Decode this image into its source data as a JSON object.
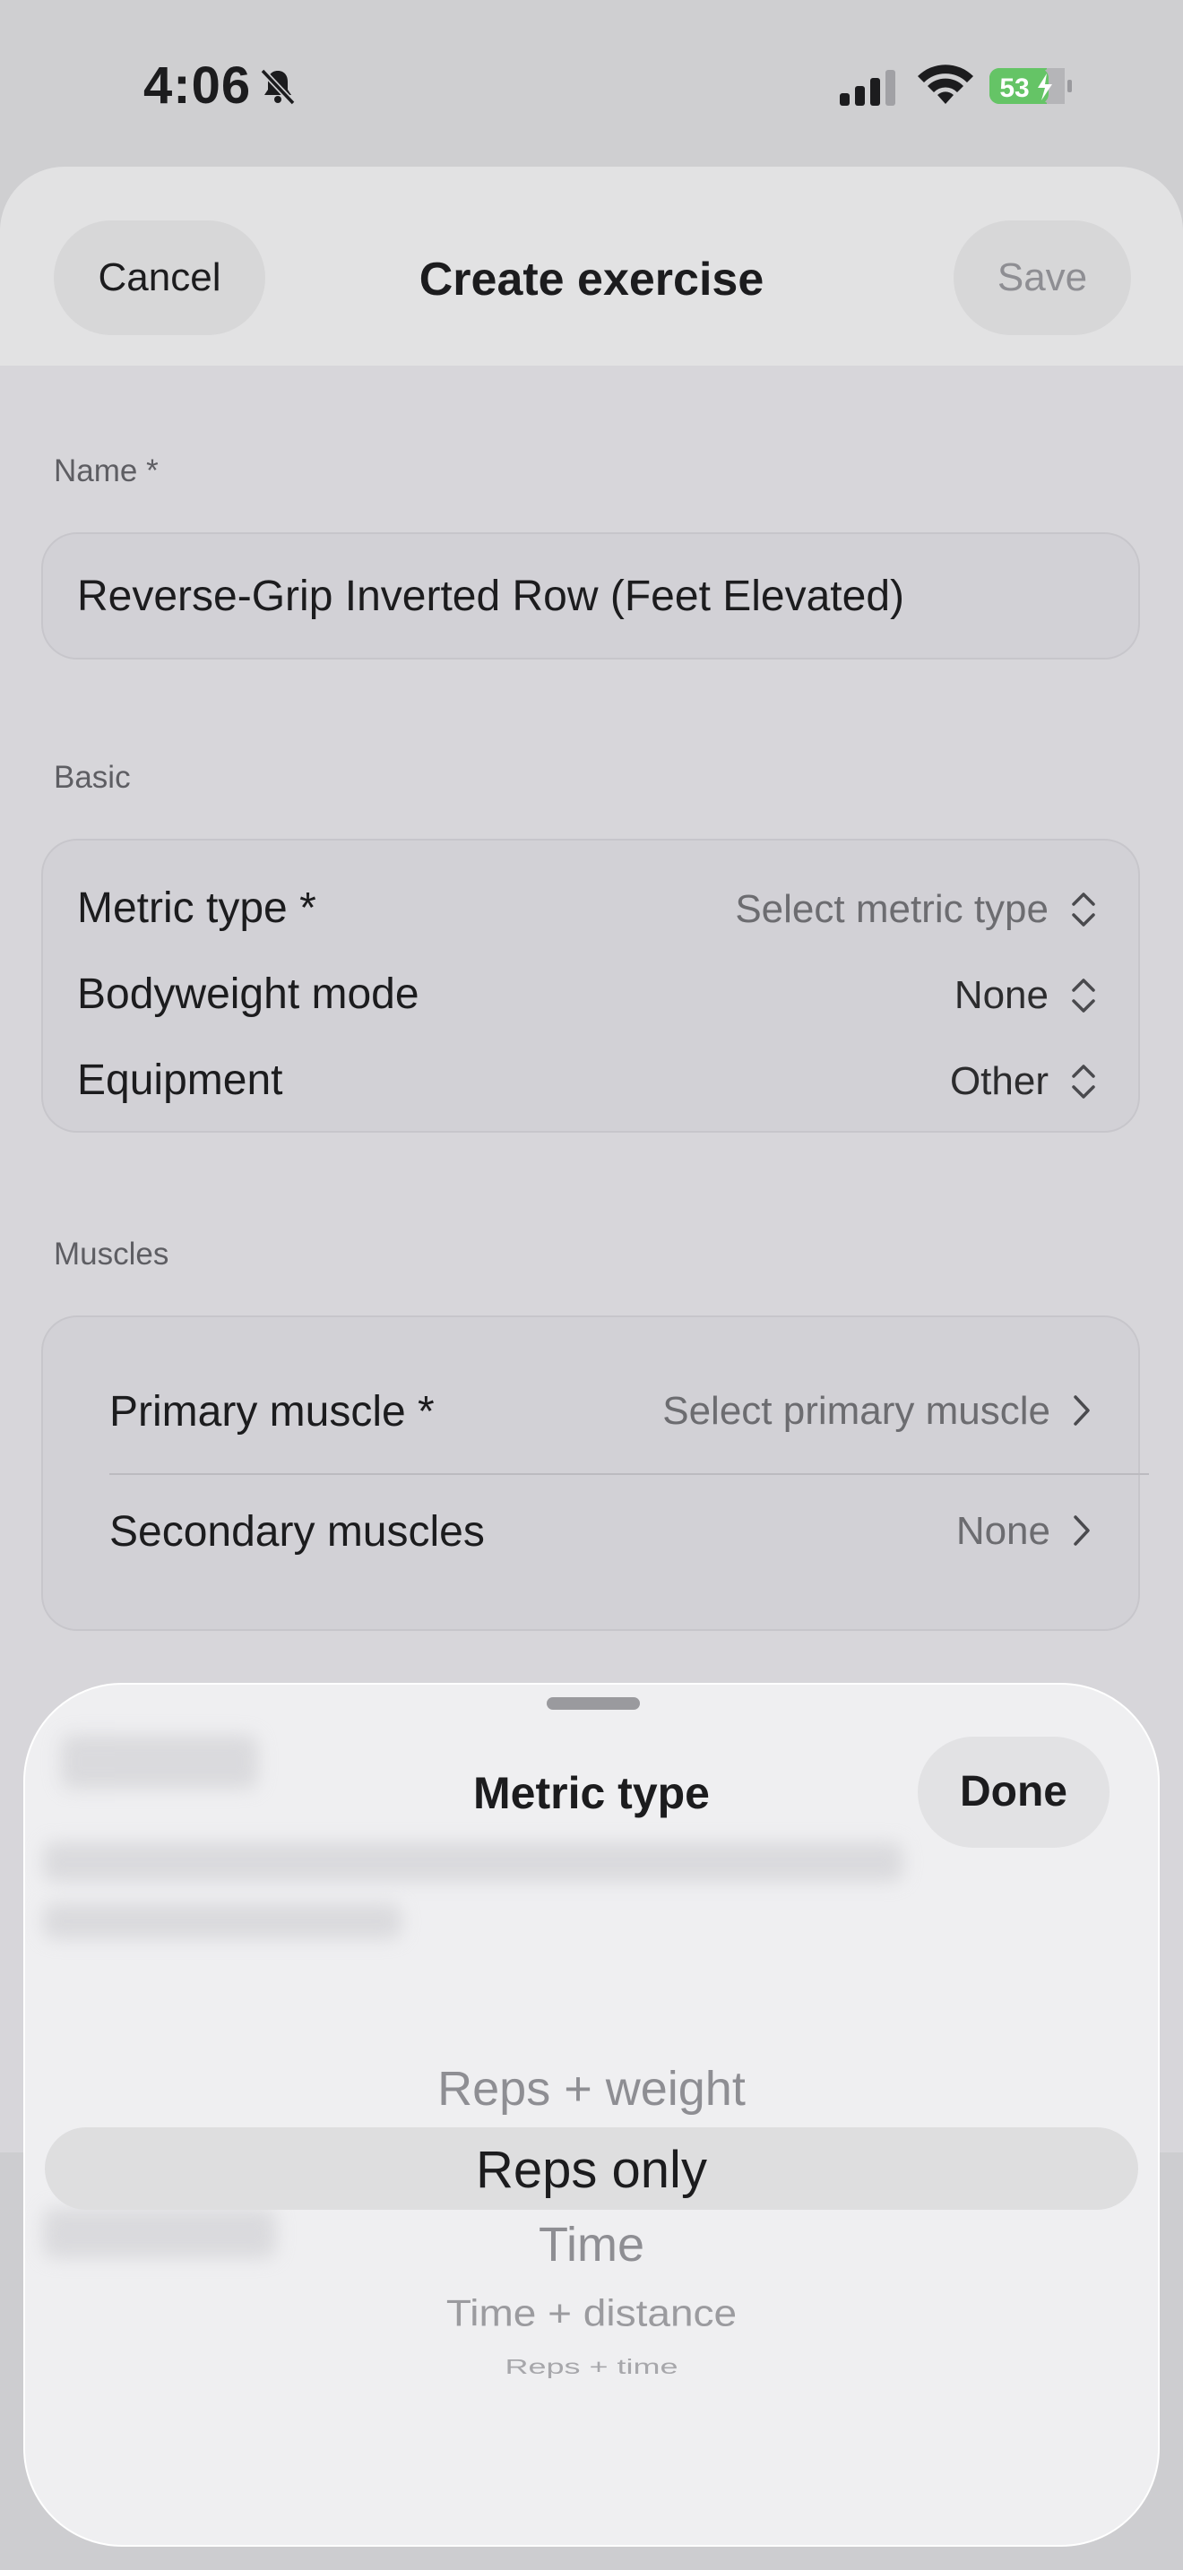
{
  "status_bar": {
    "time": "4:06",
    "battery": "53",
    "icons": [
      "bell-slash-icon",
      "cellular-signal-icon",
      "wifi-icon",
      "battery-charging-icon"
    ]
  },
  "header": {
    "cancel_label": "Cancel",
    "title": "Create exercise",
    "save_label": "Save"
  },
  "name_section": {
    "label": "Name *",
    "value": "Reverse-Grip Inverted Row (Feet Elevated)"
  },
  "basic_section": {
    "label": "Basic",
    "rows": [
      {
        "label": "Metric type *",
        "value": "Select metric type"
      },
      {
        "label": "Bodyweight mode",
        "value": "None"
      },
      {
        "label": "Equipment",
        "value": "Other"
      }
    ]
  },
  "muscles_section": {
    "label": "Muscles",
    "rows": [
      {
        "label": "Primary muscle *",
        "value": "Select primary muscle"
      },
      {
        "label": "Secondary muscles",
        "value": "None"
      }
    ]
  },
  "picker": {
    "title": "Metric type",
    "done_label": "Done",
    "options": [
      "Reps + weight",
      "Reps only",
      "Time",
      "Time + distance",
      "Reps + time"
    ],
    "selected": "Reps only"
  },
  "colors": {
    "battery_green": "#65c466",
    "sheet_background": "#d7d6da",
    "picker_background": "#efeff1"
  }
}
